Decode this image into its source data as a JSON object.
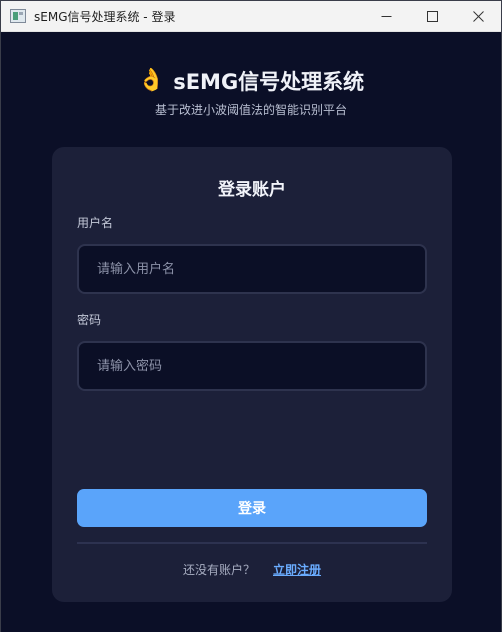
{
  "window": {
    "title": "sEMG信号处理系统 - 登录"
  },
  "header": {
    "icon": "ok-hand-emoji",
    "title": "sEMG信号处理系统",
    "subtitle": "基于改进小波阈值法的智能识别平台"
  },
  "login_card": {
    "title": "登录账户",
    "username": {
      "label": "用户名",
      "value": "",
      "placeholder": "请输入用户名"
    },
    "password": {
      "label": "密码",
      "value": "",
      "placeholder": "请输入密码"
    },
    "login_button": "登录",
    "register_prompt": "还没有账户？",
    "register_link": "立即注册"
  },
  "colors": {
    "background": "#0b0f27",
    "card": "#1c2039",
    "accent": "#5aa4fa",
    "link": "#6aacff"
  }
}
